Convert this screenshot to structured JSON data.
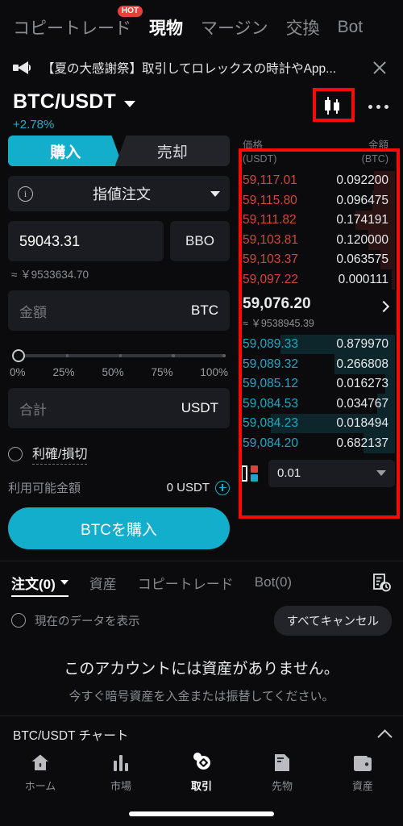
{
  "colors": {
    "accent": "#12aecb",
    "ask_red": "#d6453c",
    "bid_teal": "#1aa9c4",
    "annotation": "#fb0b06",
    "background": "#0b0b0d",
    "panel": "#1b1c21"
  },
  "top_tabs": [
    {
      "label": "コピートレード",
      "active": false,
      "badge": "HOT"
    },
    {
      "label": "現物",
      "active": true,
      "badge": ""
    },
    {
      "label": "マージン",
      "active": false,
      "badge": ""
    },
    {
      "label": "交換",
      "active": false,
      "badge": ""
    },
    {
      "label": "Bot",
      "active": false,
      "badge": ""
    }
  ],
  "announcement": {
    "icon": "megaphone-icon",
    "text": "【夏の大感謝祭】取引してロレックスの時計やApp...",
    "close_icon": "close-icon"
  },
  "pair_header": {
    "pair": "BTC/USDT",
    "change_pct": "+2.78%",
    "chart_icon": "candlestick-chart-icon",
    "more_icon": "more-options-icon"
  },
  "order_form": {
    "side_buy": "購入",
    "side_sell": "売却",
    "active_side": "購入",
    "order_type": "指値注文",
    "info_icon": "info-icon",
    "price_value": "59043.31",
    "bbo_label": "BBO",
    "price_approx": "≈ ￥9533634.70",
    "amount_placeholder": "金額",
    "amount_unit": "BTC",
    "slider_value": "0%",
    "slider_labels": [
      "0%",
      "25%",
      "50%",
      "75%",
      "100%"
    ],
    "total_placeholder": "合計",
    "total_unit": "USDT",
    "tpsl_label": "利確/損切",
    "tpsl_checked": false,
    "available_label": "利用可能金額",
    "available_value": "0 USDT",
    "add_funds_icon": "plus-circle-icon",
    "submit_label": "BTCを購入"
  },
  "orderbook": {
    "header_price": "価格",
    "header_price_unit": "(USDT)",
    "header_amount": "金額",
    "header_amount_unit": "(BTC)",
    "asks": [
      {
        "price": "59,117.01",
        "amount": "0.092200",
        "depth": 13
      },
      {
        "price": "59,115.80",
        "amount": "0.096475",
        "depth": 14
      },
      {
        "price": "59,111.82",
        "amount": "0.174191",
        "depth": 25
      },
      {
        "price": "59,103.81",
        "amount": "0.120000",
        "depth": 17
      },
      {
        "price": "59,103.37",
        "amount": "0.063575",
        "depth": 9
      },
      {
        "price": "59,097.22",
        "amount": "0.000111",
        "depth": 2
      }
    ],
    "mid": {
      "price": "59,076.20",
      "approx": "≈ ￥9538945.39",
      "chevron_icon": "chevron-right-icon"
    },
    "bids": [
      {
        "price": "59,089.33",
        "amount": "0.879970",
        "depth": 72
      },
      {
        "price": "59,089.32",
        "amount": "0.266808",
        "depth": 38
      },
      {
        "price": "59,085.12",
        "amount": "0.016273",
        "depth": 6
      },
      {
        "price": "59,084.53",
        "amount": "0.034767",
        "depth": 11
      },
      {
        "price": "59,084.23",
        "amount": "0.018494",
        "depth": 78
      },
      {
        "price": "59,084.20",
        "amount": "0.682137",
        "depth": 20
      }
    ],
    "precision_icon": "orderbook-display-mode-icon",
    "precision_value": "0.01"
  },
  "bottom_tabs": [
    {
      "label": "注文(0)",
      "active": true,
      "has_caret": true
    },
    {
      "label": "資産",
      "active": false,
      "has_caret": false
    },
    {
      "label": "コピートレード",
      "active": false,
      "has_caret": false
    },
    {
      "label": "Bot(0)",
      "active": false,
      "has_caret": false
    }
  ],
  "history_icon": "order-history-icon",
  "filter": {
    "label": "現在のデータを表示",
    "checked": false,
    "cancel_all": "すべてキャンセル"
  },
  "empty_state": {
    "title": "このアカウントには資産がありません。",
    "subtitle": "今すぐ暗号資産を入金または振替してください。"
  },
  "chart_bar": {
    "label": "BTC/USDT チャート",
    "chevron_icon": "chevron-up-icon"
  },
  "bottom_nav": [
    {
      "label": "ホーム",
      "icon": "home-icon",
      "active": false
    },
    {
      "label": "市場",
      "icon": "market-bars-icon",
      "active": false
    },
    {
      "label": "取引",
      "icon": "trade-icon",
      "active": true
    },
    {
      "label": "先物",
      "icon": "futures-icon",
      "active": false
    },
    {
      "label": "資産",
      "icon": "wallet-icon",
      "active": false
    }
  ]
}
